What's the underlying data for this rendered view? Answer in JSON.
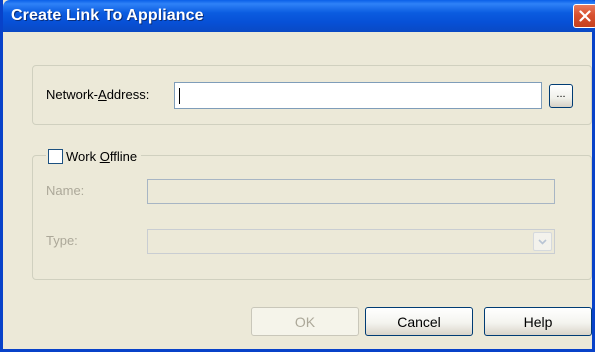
{
  "window": {
    "title": "Create Link To Appliance"
  },
  "colors": {
    "titlebar": "#0750d6",
    "close_button": "#d8512f",
    "dialog_bg": "#ece9d8",
    "disabled_text": "#aca899"
  },
  "network": {
    "label_pre": "Network-",
    "label_mnemonic": "A",
    "label_post": "ddress:",
    "value": "",
    "browse_label": "..."
  },
  "offline": {
    "checked": false,
    "label_pre": "Work ",
    "label_mnemonic": "O",
    "label_post": "ffline",
    "name_label": "Name:",
    "name_value": "",
    "type_label": "Type:",
    "type_value": ""
  },
  "buttons": {
    "ok": "OK",
    "cancel": "Cancel",
    "help": "Help"
  },
  "icons": {
    "close": "close-icon",
    "dropdown": "chevron-down-icon"
  }
}
